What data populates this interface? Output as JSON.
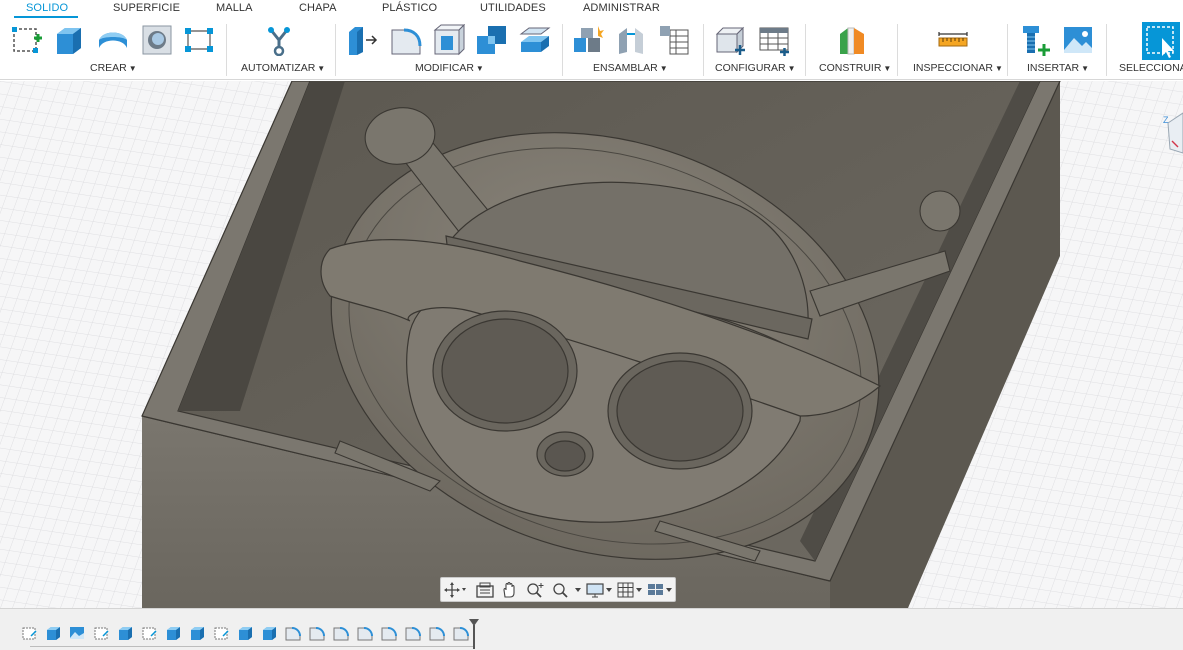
{
  "app": {
    "accent_color": "#0696d7",
    "model_color": "#6f6a61"
  },
  "tabs": [
    {
      "label": "SOLIDO",
      "active": true
    },
    {
      "label": "SUPERFICIE"
    },
    {
      "label": "MALLA"
    },
    {
      "label": "CHAPA"
    },
    {
      "label": "PLÁSTICO"
    },
    {
      "label": "UTILIDADES"
    },
    {
      "label": "ADMINISTRAR"
    }
  ],
  "toolbar": {
    "groups": [
      {
        "label": "CREAR",
        "icons": [
          "sketch-icon",
          "extrude-icon",
          "revolve-icon",
          "hole-icon",
          "pattern-icon"
        ]
      },
      {
        "label": "AUTOMATIZAR",
        "icons": [
          "automate-icon"
        ]
      },
      {
        "label": "MODIFICAR",
        "icons": [
          "press-pull-icon",
          "fillet-icon",
          "shell-icon",
          "combine-icon",
          "offset-face-icon"
        ]
      },
      {
        "label": "ENSAMBLAR",
        "icons": [
          "new-component-icon",
          "joint-icon",
          "bill-of-materials-icon"
        ]
      },
      {
        "label": "CONFIGURAR",
        "icons": [
          "configure-icon",
          "configure-table-icon"
        ]
      },
      {
        "label": "CONSTRUIR",
        "icons": [
          "construction-plane-icon"
        ]
      },
      {
        "label": "INSPECCIONAR",
        "icons": [
          "measure-icon"
        ]
      },
      {
        "label": "INSERTAR",
        "icons": [
          "insert-bolt-icon",
          "insert-image-icon"
        ]
      },
      {
        "label": "SELECCIONAR",
        "icons": [
          "select-icon"
        ]
      }
    ]
  },
  "viewport": {
    "nav_tools": [
      "orbit-icon",
      "look-at-icon",
      "pan-icon",
      "zoom-icon",
      "fit-icon",
      "display-settings-icon",
      "grid-icon",
      "viewports-icon"
    ]
  },
  "timeline": {
    "features": [
      "sketch",
      "extrude",
      "image",
      "sketch",
      "extrude",
      "sketch",
      "extrude",
      "extrude",
      "sketch",
      "extrude",
      "extrude",
      "fillet",
      "fillet",
      "fillet",
      "fillet",
      "fillet",
      "fillet",
      "fillet",
      "fillet"
    ]
  }
}
